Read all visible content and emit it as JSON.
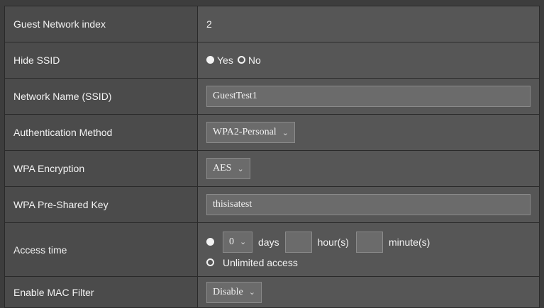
{
  "guest_index": {
    "label": "Guest Network index",
    "value": "2"
  },
  "hide_ssid": {
    "label": "Hide SSID",
    "options": [
      "Yes",
      "No"
    ],
    "selected": "Yes"
  },
  "network_name": {
    "label": "Network Name (SSID)",
    "value": "GuestTest1"
  },
  "auth_method": {
    "label": "Authentication Method",
    "value": "WPA2-Personal"
  },
  "wpa_encryption": {
    "label": "WPA Encryption",
    "value": "AES"
  },
  "psk": {
    "label": "WPA Pre-Shared Key",
    "value": "thisisatest"
  },
  "access_time": {
    "label": "Access time",
    "days_value": "0",
    "days_label": "days",
    "hours_label": "hour(s)",
    "minutes_label": "minute(s)",
    "unlimited_label": "Unlimited access",
    "selected": "limited"
  },
  "mac_filter": {
    "label": "Enable MAC Filter",
    "value": "Disable"
  },
  "colors": {
    "label_bg": "#4b4b4b",
    "value_bg": "#565656",
    "field_bg": "#6b6b6b"
  }
}
